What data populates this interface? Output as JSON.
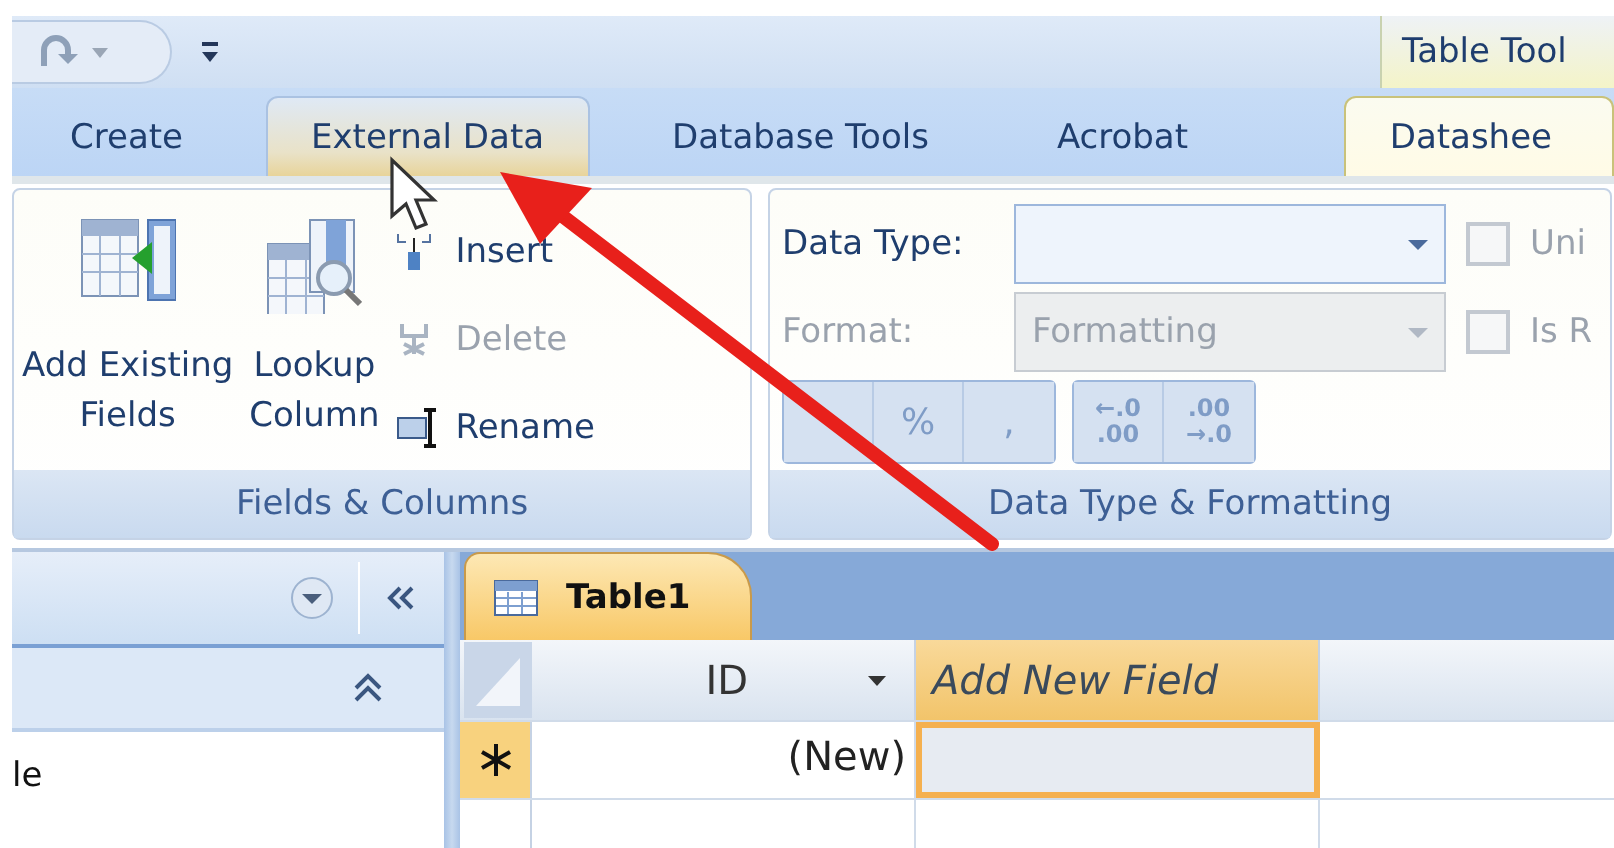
{
  "title_bar": {
    "contextual_label": "Table Tool"
  },
  "tabs": [
    {
      "label": "Create",
      "selected": false,
      "hovered": false,
      "kind": "normal"
    },
    {
      "label": "External Data",
      "selected": false,
      "hovered": true,
      "kind": "normal"
    },
    {
      "label": "Database Tools",
      "selected": false,
      "hovered": false,
      "kind": "normal"
    },
    {
      "label": "Acrobat",
      "selected": false,
      "hovered": false,
      "kind": "normal"
    },
    {
      "label": "Datashee",
      "selected": true,
      "hovered": false,
      "kind": "contextual"
    }
  ],
  "ribbon": {
    "fields_group": {
      "title": "Fields & Columns",
      "large_buttons": [
        {
          "lines": [
            "Add Existing",
            "Fields"
          ],
          "kind": "add"
        },
        {
          "lines": [
            "Lookup",
            "Column"
          ],
          "kind": "lookup"
        }
      ],
      "small_buttons": [
        {
          "label": "Insert",
          "kind": "insert",
          "disabled": false
        },
        {
          "label": "Delete",
          "kind": "delete",
          "disabled": true
        },
        {
          "label": "Rename",
          "kind": "rename",
          "disabled": false
        }
      ]
    },
    "format_group": {
      "title": "Data Type & Formatting",
      "fields": [
        {
          "label": "Data Type:",
          "disabled": false
        },
        {
          "label": "Format:",
          "value": "Formatting",
          "disabled": true
        }
      ],
      "checkboxes": [
        {
          "label": "Uni",
          "checked": false,
          "disabled": true
        },
        {
          "label": "Is R",
          "checked": false,
          "disabled": true
        }
      ],
      "button_sets": [
        [
          {
            "disabled": true
          },
          {
            "lines": [
              "%"
            ],
            "disabled": true
          },
          {
            "lines": [
              ","
            ],
            "disabled": true
          }
        ],
        [
          {
            "lines": [
              "←.0",
              ".00"
            ],
            "disabled": true
          },
          {
            "lines": [
              ".00",
              "→.0"
            ],
            "disabled": true
          }
        ]
      ]
    }
  },
  "navigation_pane": {
    "items": [
      "le"
    ]
  },
  "document_tabs": [
    {
      "label": "Table1",
      "selected": true
    }
  ],
  "datasheet": {
    "columns": [
      {
        "label": "ID",
        "kind": "field"
      },
      {
        "label": "Add New Field",
        "kind": "add_new"
      }
    ],
    "rows": [
      {
        "kind": "new_record",
        "cells": [
          {
            "value": "(New)",
            "selected": false
          },
          {
            "selected": true
          }
        ]
      }
    ]
  }
}
